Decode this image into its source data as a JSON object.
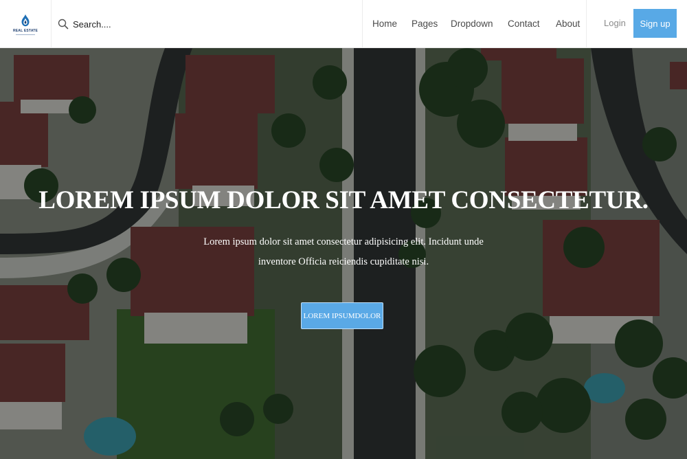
{
  "brand": {
    "logo_text": "REAL ESTATE",
    "logo_icon": "flame-drop-logo-icon",
    "color": "#1c3d6e"
  },
  "search": {
    "icon": "search-icon",
    "placeholder": "Search...."
  },
  "nav": {
    "items": [
      "Home",
      "Pages",
      "Dropdown",
      "Contact",
      "About"
    ]
  },
  "auth": {
    "login_label": "Login",
    "signup_label": "Sign up"
  },
  "hero": {
    "title": "LOREM IPSUM DOLOR SIT AMET CONSECTETUR.",
    "subtitle": "Lorem ipsum dolor sit amet consectetur adipisicing elit. Incidunt unde inventore Officia reiciendis cupiditate nisi.",
    "cta_label": "LOREM IPSUMDOLOR"
  },
  "colors": {
    "accent": "#58a9e6",
    "overlay": "#0a100e",
    "roof": "#7a3a3a",
    "tree": "#23401f",
    "road": "#2c2f30"
  }
}
